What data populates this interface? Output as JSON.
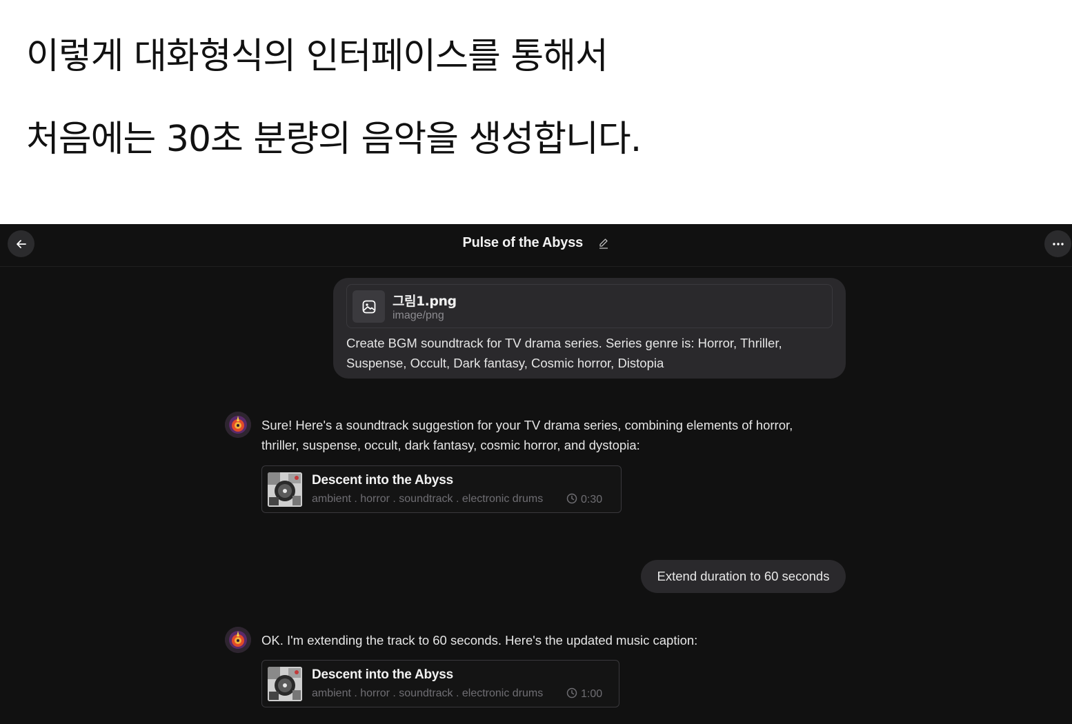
{
  "caption": {
    "line1": "이렇게 대화형식의 인터페이스를 통해서",
    "line2": "처음에는 30초 분량의 음악을 생성합니다."
  },
  "header": {
    "title": "Pulse of the Abyss",
    "back_icon": "arrow-left-icon",
    "edit_icon": "pencil-icon",
    "more_icon": "ellipsis-icon"
  },
  "messages": {
    "user1": {
      "attachment_name": "그림1.png",
      "attachment_type": "image/png",
      "text": "Create BGM soundtrack for TV drama series. Series genre is: Horror, Thriller, Suspense, Occult, Dark fantasy, Cosmic horror, Distopia"
    },
    "assistant1": {
      "text": "Sure! Here's a soundtrack suggestion for your TV drama series, combining elements of horror, thriller, suspense, occult, dark fantasy, cosmic horror, and dystopia:",
      "track": {
        "title": "Descent into the Abyss",
        "tags": "ambient . horror . soundtrack . electronic drums",
        "duration": "0:30"
      }
    },
    "user2": {
      "text": "Extend duration to 60 seconds"
    },
    "assistant2": {
      "text": "OK. I'm extending the track to 60 seconds. Here's the updated music caption:",
      "track": {
        "title": "Descent into the Abyss",
        "tags": "ambient . horror . soundtrack . electronic drums",
        "duration": "1:00"
      }
    }
  },
  "colors": {
    "background": "#111111",
    "bubble": "#2a292c",
    "text": "#e6e6e6",
    "muted": "#6f6e73"
  }
}
